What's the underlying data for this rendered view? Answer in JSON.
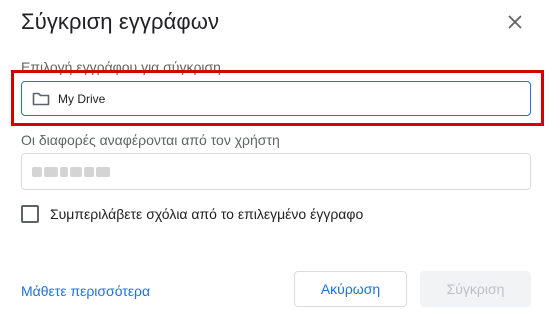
{
  "dialog": {
    "title": "Σύγκριση εγγράφων",
    "close_icon": "close-icon"
  },
  "document_picker": {
    "label": "Επιλογή εγγράφου για σύγκριση",
    "icon": "folder-icon",
    "value": "My Drive",
    "highlight_color": "#d50000"
  },
  "author_field": {
    "label": "Οι διαφορές αναφέρονται από τον χρήστη",
    "value_redacted": true
  },
  "include_comments": {
    "label": "Συμπεριλάβετε σχόλια από το επιλεγμένο έγγραφο",
    "checked": false
  },
  "footer": {
    "learn_more": "Μάθετε περισσότερα",
    "cancel_label": "Ακύρωση",
    "compare_label": "Σύγκριση",
    "compare_enabled": false
  },
  "colors": {
    "accent": "#1a73e8",
    "disabled_bg": "#f1f3f4",
    "disabled_text": "#bdc1c6"
  }
}
